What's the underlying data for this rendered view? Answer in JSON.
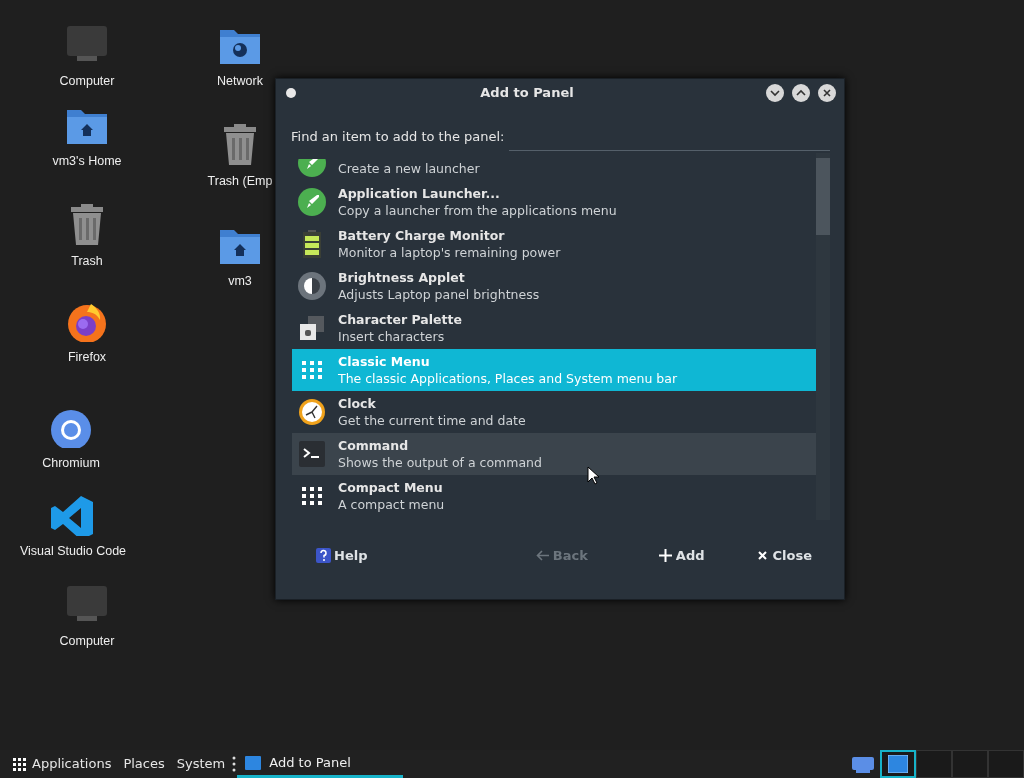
{
  "desktop": {
    "icons": [
      {
        "label": "Computer",
        "kind": "computer"
      },
      {
        "label": "vm3's Home",
        "kind": "home"
      },
      {
        "label": "Trash",
        "kind": "trash"
      },
      {
        "label": "Firefox",
        "kind": "firefox"
      },
      {
        "label": "Chromium",
        "kind": "chromium"
      },
      {
        "label": "Visual Studio Code",
        "kind": "vscode"
      },
      {
        "label": "Computer",
        "kind": "computer"
      },
      {
        "label": "Network",
        "kind": "network"
      },
      {
        "label": "Trash (Emp",
        "kind": "trash"
      },
      {
        "label": "vm3",
        "kind": "home"
      }
    ]
  },
  "dialog": {
    "title": "Add to Panel",
    "prompt": "Find an item to add to the panel:",
    "items": [
      {
        "description": "Create a new launcher",
        "kind": "rocket",
        "selected": false,
        "hovered": false
      },
      {
        "title": "Application Launcher...",
        "description": "Copy a launcher from the applications menu",
        "kind": "rocket",
        "selected": false,
        "hovered": false
      },
      {
        "title": "Battery Charge Monitor",
        "description": "Monitor a laptop's remaining power",
        "kind": "battery",
        "selected": false,
        "hovered": false
      },
      {
        "title": "Brightness Applet",
        "description": "Adjusts Laptop panel brightness",
        "kind": "brightness",
        "selected": false,
        "hovered": false
      },
      {
        "title": "Character Palette",
        "description": "Insert characters",
        "kind": "charpalette",
        "selected": false,
        "hovered": false
      },
      {
        "title": "Classic Menu",
        "description": "The classic Applications, Places and System menu bar",
        "kind": "grid",
        "selected": true,
        "hovered": false
      },
      {
        "title": "Clock",
        "description": "Get the current time and date",
        "kind": "clock",
        "selected": false,
        "hovered": false
      },
      {
        "title": "Command",
        "description": "Shows the output of a command",
        "kind": "terminal",
        "selected": false,
        "hovered": true
      },
      {
        "title": "Compact Menu",
        "description": "A compact menu",
        "kind": "grid",
        "selected": false,
        "hovered": false
      }
    ],
    "buttons": [
      {
        "label": "Help",
        "kind": "help",
        "disabled": false
      },
      {
        "label": "Back",
        "kind": "back",
        "disabled": true
      },
      {
        "label": "Add",
        "kind": "add",
        "disabled": false
      },
      {
        "label": "Close",
        "kind": "close",
        "disabled": false
      }
    ]
  },
  "taskbar": {
    "menus": [
      "Applications",
      "Places",
      "System"
    ],
    "tasks": [
      {
        "label": "Add to Panel",
        "selected": true
      }
    ],
    "workspaces": [
      {
        "selected": true
      },
      {
        "selected": false
      },
      {
        "selected": false
      },
      {
        "selected": false
      }
    ]
  }
}
